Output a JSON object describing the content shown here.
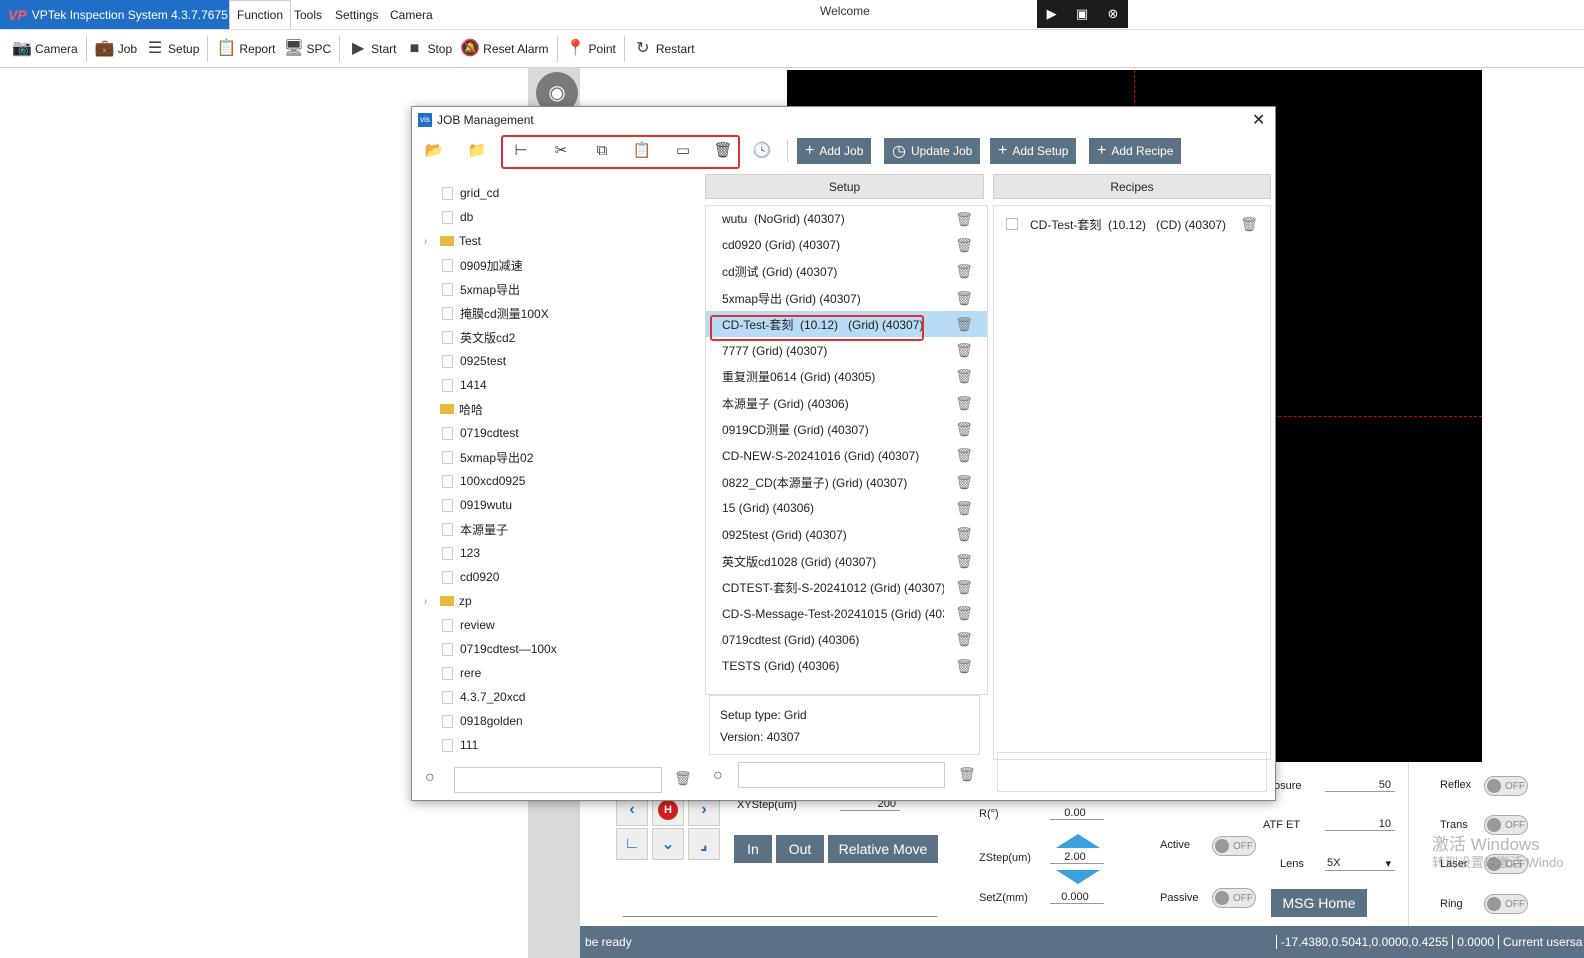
{
  "app": {
    "brand": "VPTek Inspection System 4.3.7.7675",
    "welcome": "Welcome"
  },
  "menu": [
    {
      "label": "Function"
    },
    {
      "label": "Tools"
    },
    {
      "label": "Settings"
    },
    {
      "label": "Camera"
    }
  ],
  "toolbar": {
    "camera": "Camera",
    "job": "Job",
    "setup": "Setup",
    "report": "Report",
    "spc": "SPC",
    "start": "Start",
    "stop": "Stop",
    "reset_alarm": "Reset Alarm",
    "point": "Point",
    "restart": "Restart"
  },
  "dialog": {
    "title": "JOB Management",
    "add_job": "Add Job",
    "update_job": "Update Job",
    "add_setup": "Add Setup",
    "add_recipe": "Add Recipe",
    "setup_header": "Setup",
    "recipes_header": "Recipes",
    "tree": [
      "grid_cd",
      "db",
      "Test",
      "0909加减速",
      "5xmap导出",
      "掩膜cd测量100X",
      "英文版cd2",
      "0925test",
      "1414",
      "哈哈",
      "0719cdtest",
      "5xmap导出02",
      "100xcd0925",
      "0919wutu",
      "本源量子",
      "123",
      "cd0920",
      "zp",
      "review",
      "0719cdtest—100x",
      "rere",
      "4.3.7_20xcd",
      "0918golden",
      "111"
    ],
    "setups": [
      "wutu  (NoGrid) (40307)",
      "cd0920 (Grid) (40307)",
      "cd测试 (Grid) (40307)",
      "5xmap导出 (Grid) (40307)",
      "CD-Test-套刻  (10.12)   (Grid) (40307)",
      "7777 (Grid) (40307)",
      "重复测量0614 (Grid) (40305)",
      "本源量子 (Grid) (40306)",
      "0919CD测量 (Grid) (40307)",
      "CD-NEW-S-20241016 (Grid) (40307)",
      "0822_CD(本源量子) (Grid) (40307)",
      "15 (Grid) (40306)",
      "0925test (Grid) (40307)",
      "英文版cd1028 (Grid) (40307)",
      "CDTEST-套刻-S-20241012 (Grid) (40307)",
      "CD-S-Message-Test-20241015 (Grid) (403",
      "0719cdtest (Grid) (40306)",
      "TESTS (Grid) (40306)"
    ],
    "setup_info": {
      "type": "Setup type:  Grid",
      "version": "Version:  40307"
    },
    "recipes": [
      "CD-Test-套刻  (10.12)   (CD) (40307)"
    ]
  },
  "control": {
    "xystep_label": "XYStep(um)",
    "xystep_value": "200",
    "in": "In",
    "out": "Out",
    "relative_move": "Relative Move",
    "r_label": "R(°)",
    "r_value": "0.00",
    "zstep_label": "ZStep(um)",
    "zstep_value": "2.00",
    "setz_label": "SetZ(mm)",
    "setz_value": "0.000",
    "active": "Active",
    "passive": "Passive",
    "off": "OFF",
    "exposure_label": "osure",
    "exposure_value": "50",
    "atf_label": "ATF ET",
    "atf_value": "10",
    "lens_label": "Lens",
    "lens_value": "5X",
    "msg_home": "MSG Home",
    "reflex": "Reflex",
    "trans": "Trans",
    "laser": "Laser",
    "ring": "Ring",
    "home_glyph": "H",
    "watermark1": "激活 Windows",
    "watermark2": "转到设置以激活 Windo"
  },
  "status": {
    "ready": "be ready",
    "coords": "-17.4380,0.5041,0.0000,0.4255",
    "value": "0.0000",
    "user": "Current usersa"
  }
}
